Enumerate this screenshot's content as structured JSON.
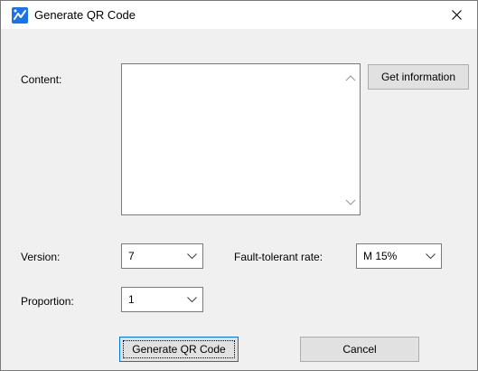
{
  "window": {
    "title": "Generate QR Code",
    "close_glyph": "close-icon"
  },
  "colors": {
    "title_bg": "#ffffff",
    "dialog_bg": "#f0f0f0",
    "accent": "#0078d7",
    "icon_blue": "#1a73e8"
  },
  "content": {
    "label": "Content:",
    "value": "",
    "get_info_button": "Get information"
  },
  "version": {
    "label": "Version:",
    "selected": "7"
  },
  "fault_tolerant": {
    "label": "Fault-tolerant rate:",
    "selected": "M 15%"
  },
  "proportion": {
    "label": "Proportion:",
    "selected": "1"
  },
  "actions": {
    "generate_button": "Generate QR Code",
    "cancel_button": "Cancel"
  }
}
